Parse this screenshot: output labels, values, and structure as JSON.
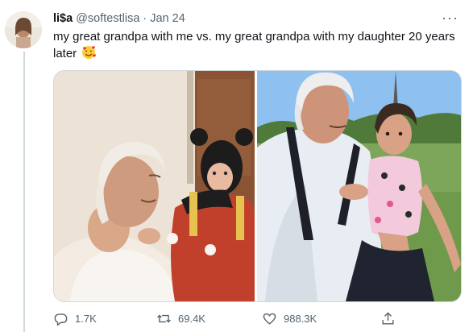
{
  "tweet": {
    "author_name": "li$a",
    "author_handle": "@softestlisa",
    "separator": "·",
    "date": "Jan 24",
    "more_label": "···",
    "text": "my great grandpa with me vs. my great grandpa with my daughter 20 years later"
  },
  "media": {
    "left_photo_icon": "photo-vintage-grandpa-with-baby",
    "right_photo_icon": "photo-grandpa-with-toddler-outdoors"
  },
  "actions": {
    "reply_count": "1.7K",
    "retweet_count": "69.4K",
    "like_count": "988.3K"
  },
  "colors": {
    "text_primary": "#0f1419",
    "text_secondary": "#536471",
    "border": "#cfd9de",
    "thread_line": "#cfd9de"
  }
}
